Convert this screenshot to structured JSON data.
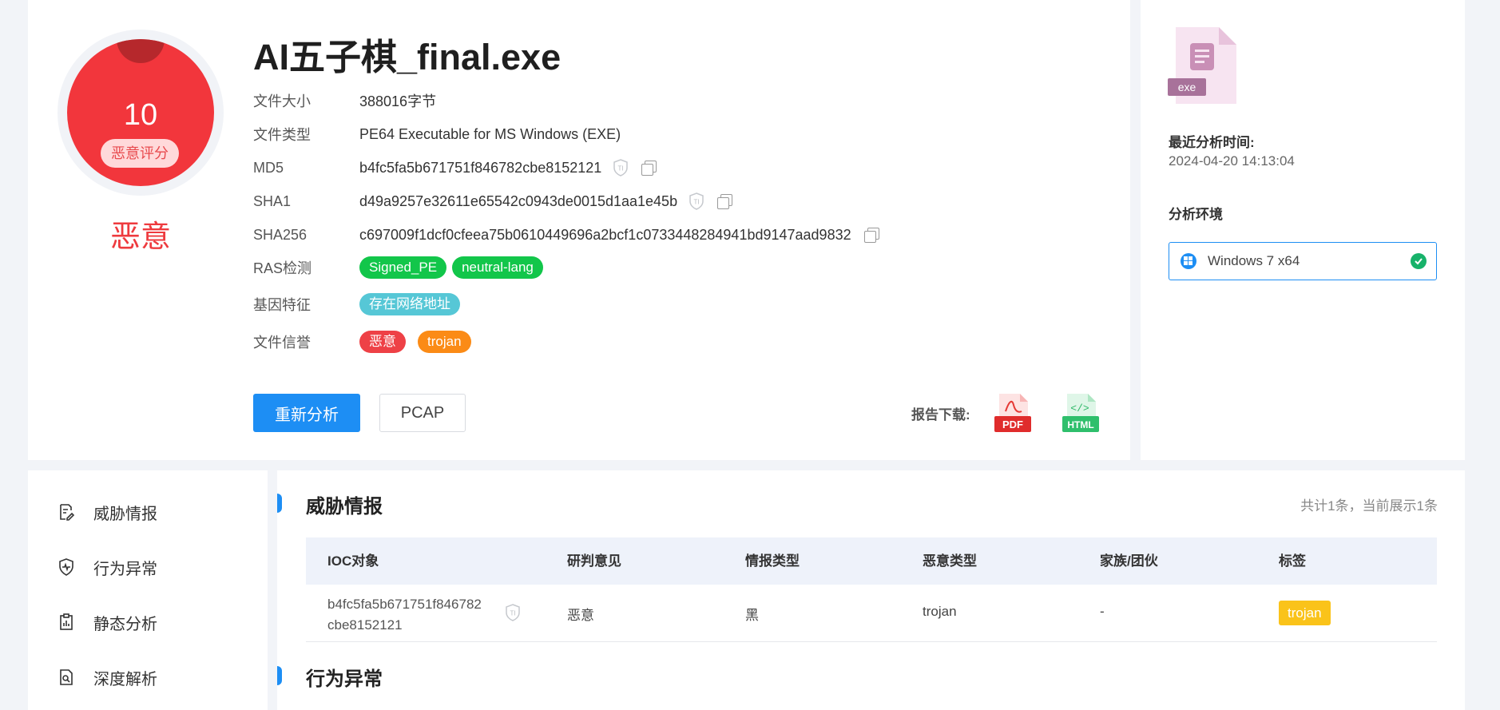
{
  "score": {
    "value": "10",
    "tag": "恶意评分",
    "verdict": "恶意"
  },
  "file": {
    "name": "AI五子棋_final.exe",
    "rows": [
      {
        "label": "文件大小",
        "value": "388016字节"
      },
      {
        "label": "文件类型",
        "value": "PE64 Executable for MS Windows (EXE)"
      },
      {
        "label": "MD5",
        "value": "b4fc5fa5b671751f846782cbe8152121"
      },
      {
        "label": "SHA1",
        "value": "d49a9257e32611e65542c0943de0015d1aa1e45b"
      },
      {
        "label": "SHA256",
        "value": "c697009f1dcf0cfeea75b0610449696a2bcf1c0733448284941bd9147aad9832"
      },
      {
        "label": "RAS检测",
        "tags": [
          "Signed_PE",
          "neutral-lang"
        ]
      },
      {
        "label": "基因特征",
        "tags": [
          "存在网络地址"
        ]
      },
      {
        "label": "文件信誉",
        "tags": [
          "恶意",
          "trojan"
        ]
      }
    ]
  },
  "actions": {
    "reanalyze": "重新分析",
    "pcap": "PCAP",
    "download_label": "报告下载:",
    "pdf": "PDF",
    "html": "HTML",
    "ti": "TI"
  },
  "side": {
    "file_ext": "exe",
    "last_analysis_label": "最近分析时间:",
    "last_analysis_time": "2024-04-20 14:13:04",
    "env_label": "分析环境",
    "env_value": "Windows 7 x64"
  },
  "nav": {
    "items": [
      "威胁情报",
      "行为异常",
      "静态分析",
      "深度解析"
    ]
  },
  "threat": {
    "title": "威胁情报",
    "count": "共计1条，当前展示1条",
    "columns": [
      "IOC对象",
      "研判意见",
      "情报类型",
      "恶意类型",
      "家族/团伙",
      "标签"
    ],
    "rows": [
      {
        "ioc_line1": "b4fc5fa5b671751f846782",
        "ioc_line2": "cbe8152121",
        "opinion": "恶意",
        "intel_type": "黑",
        "malware_type": "trojan",
        "family": "-",
        "tag": "trojan"
      }
    ]
  },
  "behavior": {
    "title": "行为异常"
  },
  "colors": {
    "accent": "#1d8ef4",
    "danger": "#f2363c",
    "green": "#12c64a",
    "cyan": "#56c7d6",
    "orange": "#fb8b16",
    "yellow": "#fac31a"
  }
}
